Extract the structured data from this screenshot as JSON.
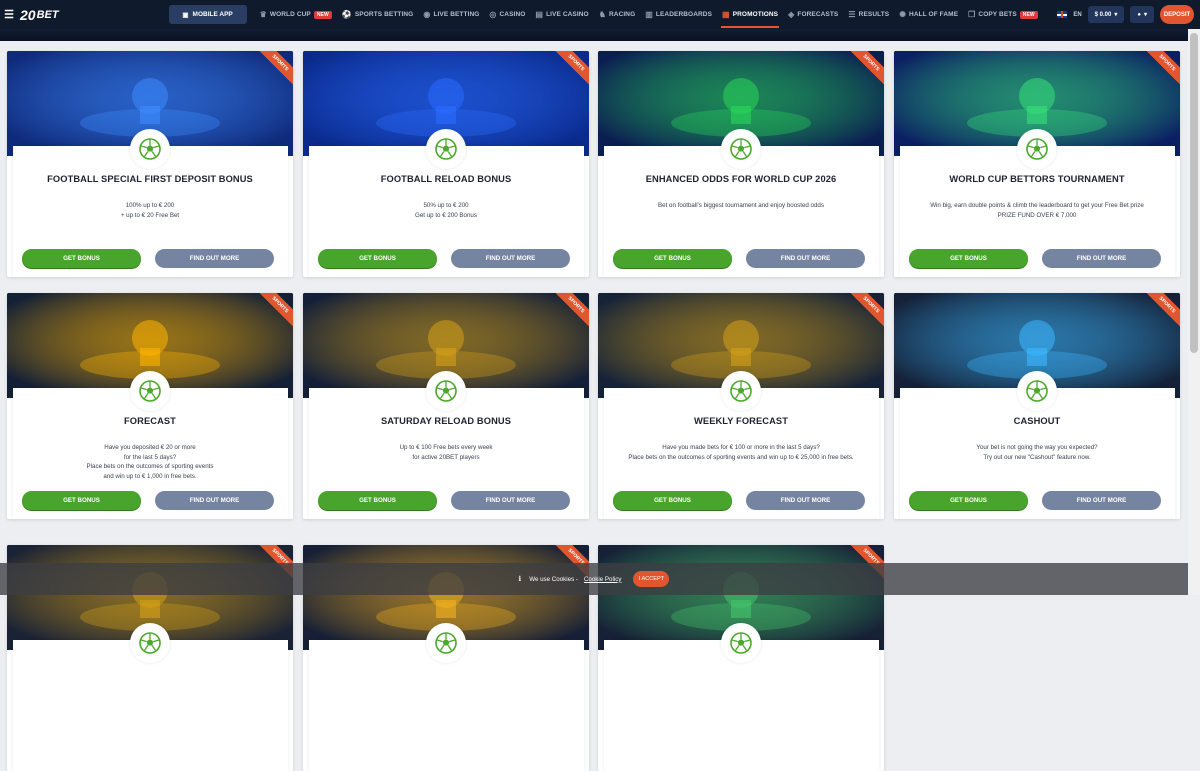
{
  "topbar": {
    "logo_number": "20",
    "logo_text": "BET",
    "mobile_app": "MOBILE APP",
    "nav": [
      {
        "label": "WORLD CUP",
        "icon": "trophy-icon",
        "badge": "NEW",
        "active": false
      },
      {
        "label": "SPORTS BETTING",
        "icon": "soccer-ball-icon",
        "badge": "",
        "active": false
      },
      {
        "label": "LIVE BETTING",
        "icon": "live-icon",
        "badge": "",
        "active": false
      },
      {
        "label": "CASINO",
        "icon": "casino-chip-icon",
        "badge": "",
        "active": false
      },
      {
        "label": "LIVE CASINO",
        "icon": "cards-icon",
        "badge": "",
        "active": false
      },
      {
        "label": "RACING",
        "icon": "horse-icon",
        "badge": "",
        "active": false
      },
      {
        "label": "LEADERBOARDS",
        "icon": "chart-icon",
        "badge": "",
        "active": false
      },
      {
        "label": "PROMOTIONS",
        "icon": "gift-icon",
        "badge": "",
        "active": true
      },
      {
        "label": "FORECASTS",
        "icon": "forecast-icon",
        "badge": "",
        "active": false
      },
      {
        "label": "RESULTS",
        "icon": "results-icon",
        "badge": "",
        "active": false
      },
      {
        "label": "HALL OF FAME",
        "icon": "laurel-icon",
        "badge": "",
        "active": false
      },
      {
        "label": "COPY BETS",
        "icon": "copy-icon",
        "badge": "NEW",
        "active": false
      }
    ],
    "language": "EN",
    "balance": "$ 0.00",
    "deposit": "DEPOSIT"
  },
  "cards": [
    {
      "tag": "SPORTS",
      "title": "FOOTBALL SPECIAL FIRST DEPOSIT BONUS",
      "lines": [
        "100% up to € 200",
        "+ up to € 20 Free Bet"
      ],
      "theme": "#0f2a7a"
    },
    {
      "tag": "SPORTS",
      "title": "FOOTBALL RELOAD BONUS",
      "lines": [
        "50% up to € 200",
        "Get up to € 200 Bonus"
      ],
      "theme": "#0a2a8c"
    },
    {
      "tag": "SPORTS",
      "title": "ENHANCED ODDS FOR WORLD CUP 2026",
      "lines": [
        "Bet on football's biggest tournament and enjoy boosted odds"
      ],
      "theme": "#0b1e52"
    },
    {
      "tag": "SPORTS",
      "title": "WORLD CUP BETTORS TOURNAMENT",
      "lines": [
        "Win big, earn double points & climb the leaderboard to get your Free Bet prize",
        "PRIZE FUND OVER € 7,000"
      ],
      "theme": "#0b2063"
    },
    {
      "tag": "SPORTS",
      "title": "FORECAST",
      "lines": [
        "Have you deposited € 20 or more",
        "for the last 5 days?",
        "Place bets on the outcomes of sporting events",
        "and win up to € 1,000 in free bets."
      ],
      "theme": "#142036"
    },
    {
      "tag": "SPORTS",
      "title": "SATURDAY RELOAD BONUS",
      "lines": [
        "Up to € 100 Free bets every week",
        "for active 20BET players"
      ],
      "theme": "#141f38"
    },
    {
      "tag": "SPORTS",
      "title": "WEEKLY FORECAST",
      "lines": [
        "Have you made bets for € 100 or more in the last 5 days?",
        "Place bets on the outcomes of sporting events and win up to € 25,000 in free bets."
      ],
      "theme": "#152238"
    },
    {
      "tag": "SPORTS",
      "title": "CASHOUT",
      "lines": [
        "Your bet is not going the way you expected?",
        "Try out our new \"Cashout\" feature now."
      ],
      "theme": "#142138"
    },
    {
      "tag": "SPORTS",
      "title": "",
      "lines": [],
      "theme": "#1a2235"
    },
    {
      "tag": "SPORTS",
      "title": "",
      "lines": [],
      "theme": "#161f36"
    },
    {
      "tag": "SPORTS",
      "title": "",
      "lines": [],
      "theme": "#162036"
    }
  ],
  "buttons": {
    "get_bonus": "GET BONUS",
    "find_out_more": "FIND OUT MORE"
  },
  "cookie": {
    "text": "We use Cookies - ",
    "link": "Cookie Policy",
    "accept": "I ACCEPT"
  }
}
